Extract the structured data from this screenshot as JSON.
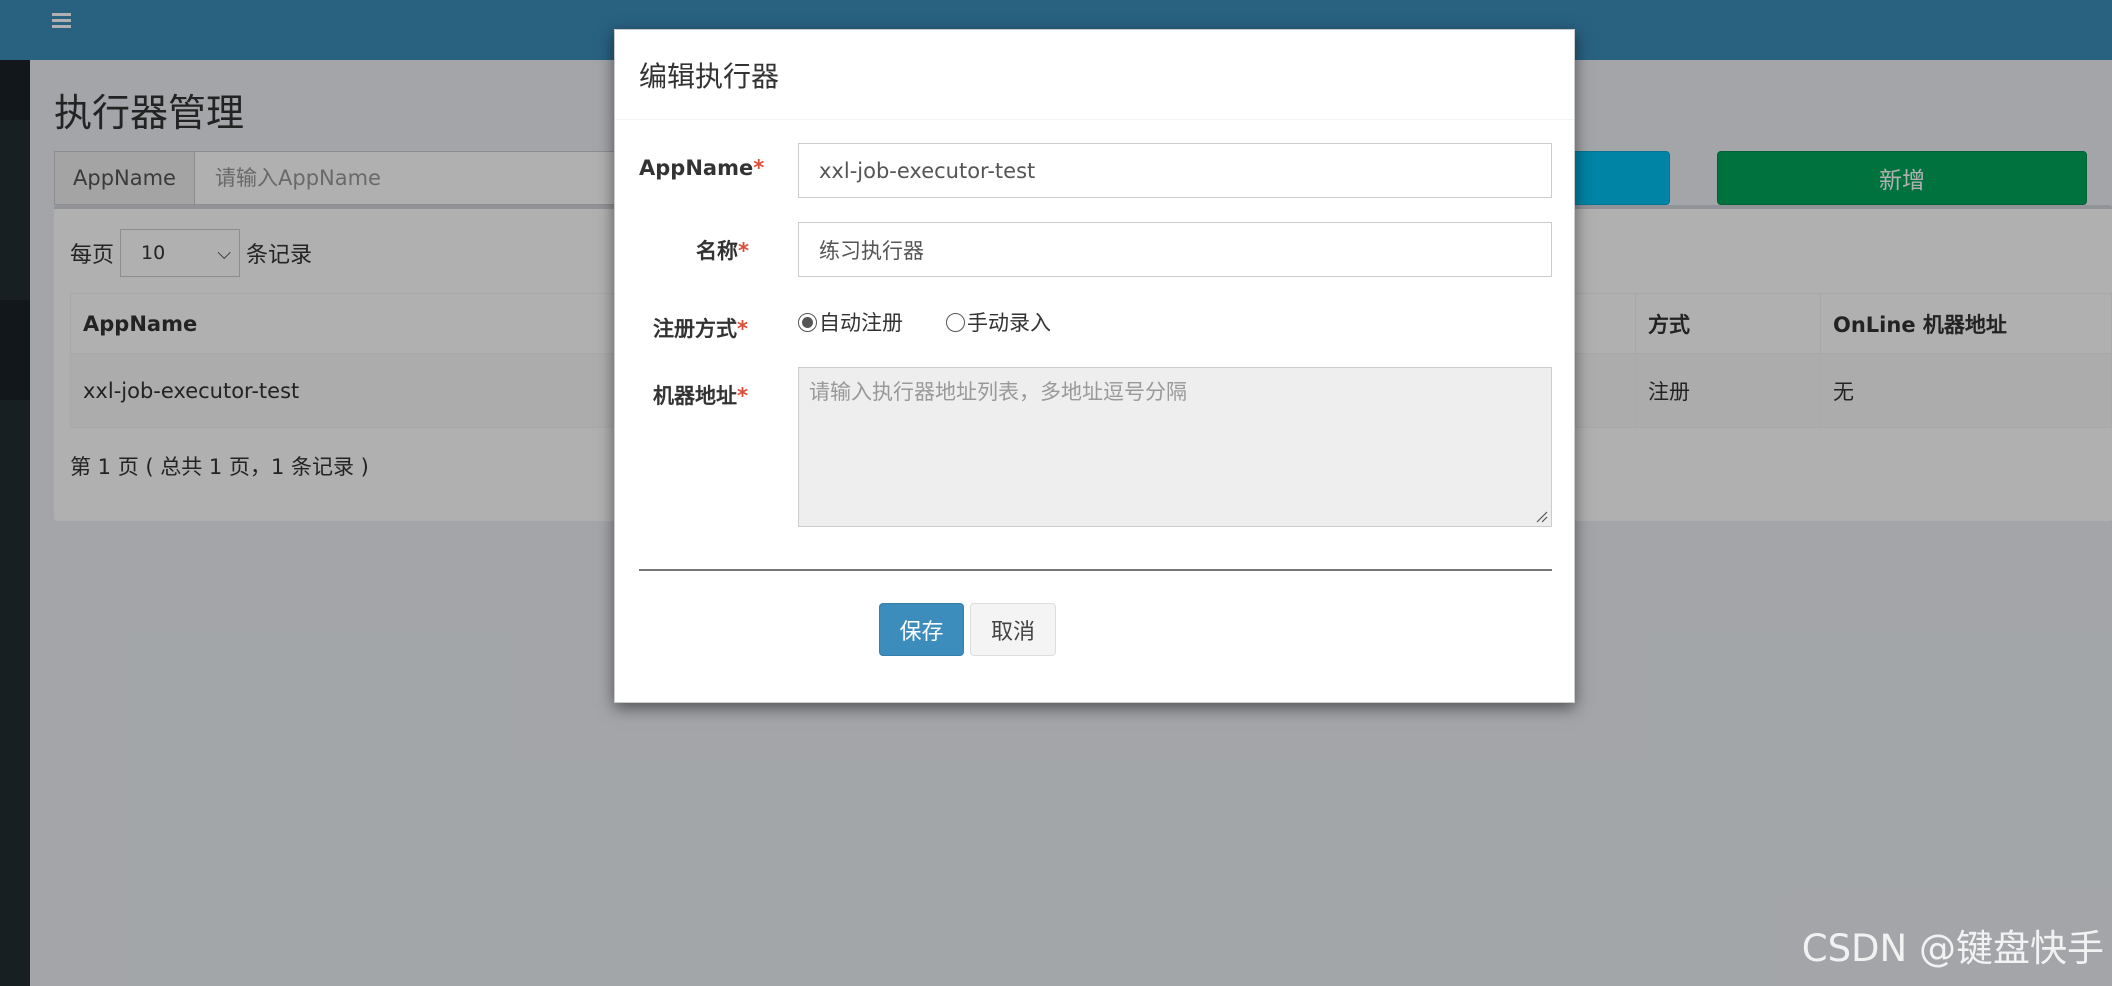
{
  "page": {
    "title": "执行器管理"
  },
  "search": {
    "addon_label": "AppName",
    "placeholder": "请输入AppName",
    "add_label": "新增"
  },
  "list": {
    "page_size_prefix": "每页",
    "page_size_value": "10",
    "page_size_suffix": "条记录",
    "columns": [
      "AppName",
      "方式",
      "OnLine 机器地址"
    ],
    "rows": [
      {
        "appname": "xxl-job-executor-test",
        "type": "注册",
        "online": "无"
      }
    ],
    "pager": "第 1 页 ( 总共 1 页，1 条记录 )"
  },
  "modal": {
    "title": "编辑执行器",
    "appname_label": "AppName",
    "appname_value": "xxl-job-executor-test",
    "name_label": "名称",
    "name_value": "练习执行器",
    "reg_label": "注册方式",
    "reg_auto": "自动注册",
    "reg_manual": "手动录入",
    "reg_selected": "auto",
    "addr_label": "机器地址",
    "addr_placeholder": "请输入执行器地址列表，多地址逗号分隔",
    "required_mark": "*",
    "save_label": "保存",
    "cancel_label": "取消"
  },
  "watermark": "CSDN @键盘快手",
  "colors": {
    "header": "#3c8dbc",
    "add_button": "#00a65a",
    "search_button": "#00c0ef",
    "save_button": "#3c8dbc",
    "required": "#dd4b39"
  }
}
